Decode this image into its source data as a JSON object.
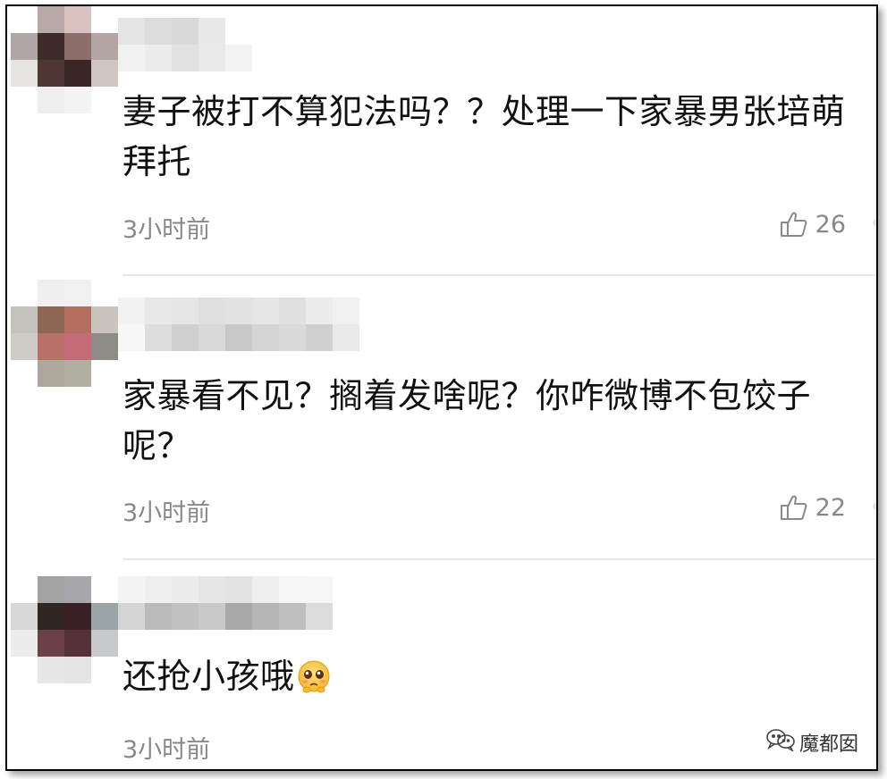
{
  "comments": [
    {
      "text": "妻子被打不算犯法吗？？处理一下家暴男张培萌拜托",
      "time": "3小时前",
      "likes": "26",
      "avatar_pixels": [
        "#ffffff",
        "#b9a8a8",
        "#d9c2bf",
        "#ffffff",
        "#b0a6a5",
        "#3f2c2a",
        "#8c6e6b",
        "#b3a5a3",
        "#e7e3e3",
        "#4d3634",
        "#3a2624",
        "#cfc6c4",
        "#ffffff",
        "#eeeeee",
        "#f4f4f4",
        "#ffffff"
      ],
      "name_pixels": [
        [
          "#e4e4e4",
          "#dcdcdc",
          "#d9d9d9",
          "#e8e8e8",
          "#ffffff"
        ],
        [
          "#f1f1f1",
          "#ececec",
          "#e1e1e1",
          "#e9e9e9",
          "#f3f3f3"
        ]
      ]
    },
    {
      "text": "家暴看不见？搁着发啥呢？你咋微博不包饺子呢？",
      "time": "3小时前",
      "likes": "22",
      "avatar_pixels": [
        "#ffffff",
        "#efefef",
        "#f0f0f0",
        "#ffffff",
        "#c5c1bd",
        "#8e6752",
        "#b36e5f",
        "#c9c4c0",
        "#cfccc8",
        "#b87068",
        "#c56d76",
        "#8f8c88",
        "#ffffff",
        "#aca99c",
        "#b1aea2",
        "#ffffff"
      ],
      "name_pixels": [
        [
          "#f2f2f2",
          "#e8e8e8",
          "#e6e6e6",
          "#e0e0e0",
          "#e2e2e2",
          "#e6e6e6",
          "#e0e0e0",
          "#ececec",
          "#f0f0f0"
        ],
        [
          "#f7f7f7",
          "#dddddd",
          "#cfcfcf",
          "#d9d9d9",
          "#c8c8c8",
          "#d4d4d4",
          "#dadada",
          "#d0d0d0",
          "#e9e9e9"
        ]
      ]
    },
    {
      "text": "还抢小孩哦",
      "time": "3小时前",
      "likes": "",
      "avatar_pixels": [
        "#ffffff",
        "#a3a3a3",
        "#a7a7ab",
        "#ffffff",
        "#d7d7d7",
        "#302624",
        "#3a1f24",
        "#9aa5a8",
        "#ececec",
        "#6b4048",
        "#55323a",
        "#c7c9cb",
        "#ffffff",
        "#e7e7e7",
        "#e4e4e4",
        "#ffffff"
      ],
      "name_pixels": [
        [
          "#f3f3f3",
          "#eeeeee",
          "#ececec",
          "#e6e6e6",
          "#e3e3e3",
          "#efefef",
          "#f5f5f5",
          "#f6f6f6"
        ],
        [
          "#d4d4d4",
          "#bababa",
          "#c1c1c1",
          "#c9c9c9",
          "#a8a8a8",
          "#b5b5b5",
          "#bebebe",
          "#dcdcdc"
        ]
      ]
    }
  ],
  "emoji_name": "pleading-face-icon",
  "like_icon_name": "thumbs-up-icon",
  "watermark": {
    "text": "魔都囡",
    "icon": "wechat-icon"
  },
  "colors": {
    "frame_border": "#000000",
    "meta_text": "#888888",
    "divider": "#e8e8e8",
    "comment_text": "#111111"
  }
}
